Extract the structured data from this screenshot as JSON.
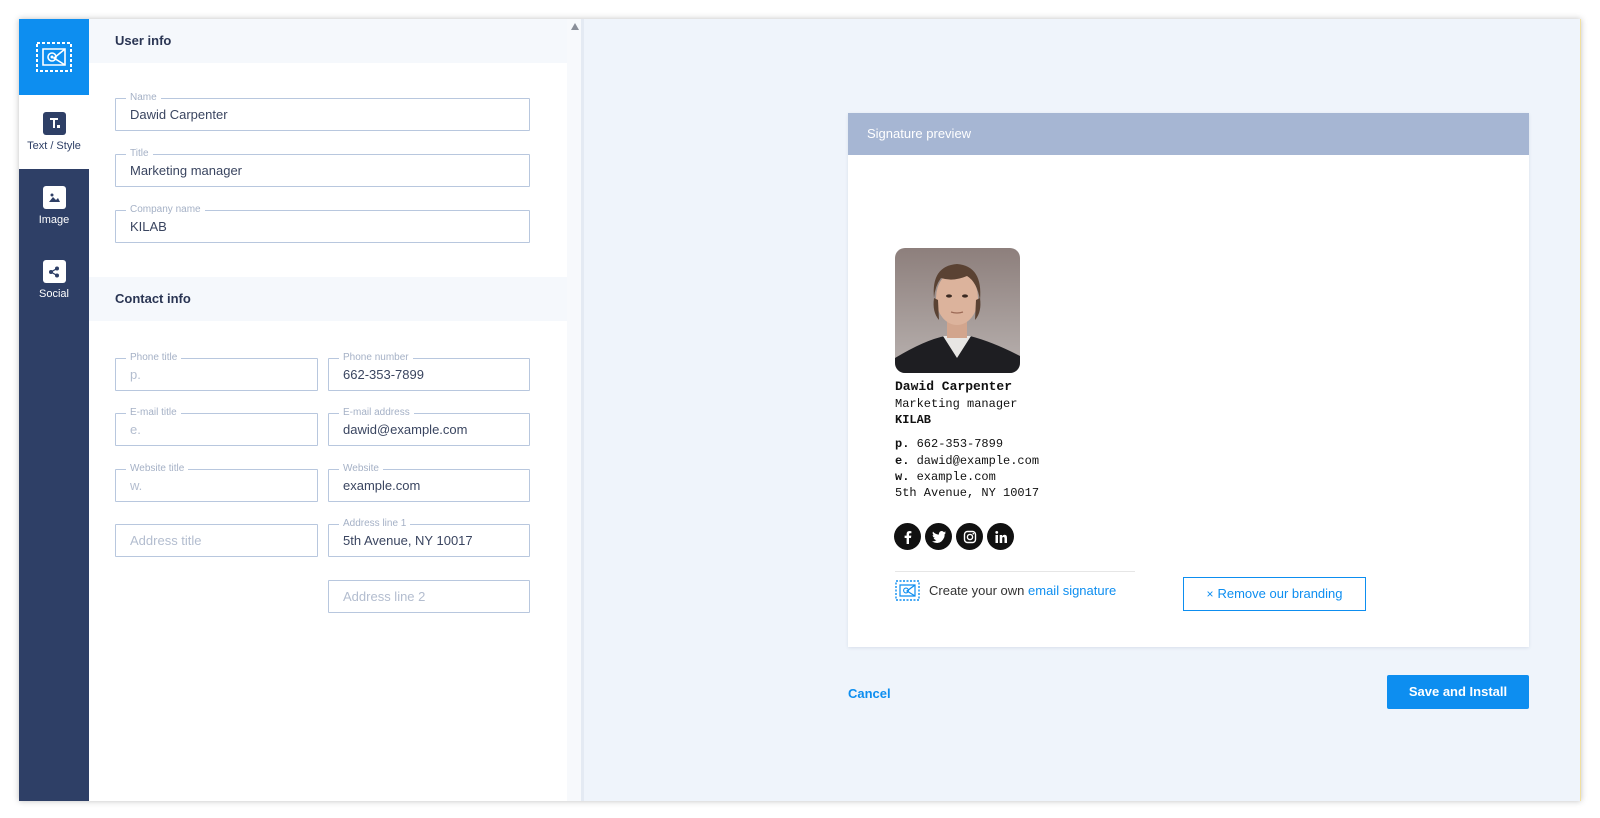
{
  "sidebar": {
    "items": [
      {
        "label": "Text / Style",
        "icon": "text-style-icon"
      },
      {
        "label": "Image",
        "icon": "image-icon"
      },
      {
        "label": "Social",
        "icon": "share-icon"
      }
    ]
  },
  "user_info": {
    "heading": "User info",
    "name": {
      "label": "Name",
      "value": "Dawid Carpenter"
    },
    "title": {
      "label": "Title",
      "value": "Marketing manager"
    },
    "company": {
      "label": "Company name",
      "value": "KILAB"
    }
  },
  "contact_info": {
    "heading": "Contact info",
    "phone_title": {
      "label": "Phone title",
      "placeholder": "p."
    },
    "phone_number": {
      "label": "Phone number",
      "value": "662-353-7899"
    },
    "email_title": {
      "label": "E-mail title",
      "placeholder": "e."
    },
    "email_address": {
      "label": "E-mail address",
      "value": "dawid@example.com"
    },
    "website_title": {
      "label": "Website title",
      "placeholder": "w."
    },
    "website": {
      "label": "Website",
      "value": "example.com"
    },
    "address_title": {
      "placeholder": "Address title"
    },
    "address_line1": {
      "label": "Address line 1",
      "value": "5th Avenue, NY 10017"
    },
    "address_line2": {
      "placeholder": "Address line 2"
    }
  },
  "preview": {
    "header": "Signature preview",
    "name": "Dawid Carpenter",
    "title": "Marketing manager",
    "company": "KILAB",
    "phone_prefix": "p.",
    "phone": "662-353-7899",
    "email_prefix": "e.",
    "email": "dawid@example.com",
    "web_prefix": "w.",
    "website": "example.com",
    "address": "5th Avenue, NY 10017",
    "social_icons": [
      "facebook-icon",
      "twitter-icon",
      "instagram-icon",
      "linkedin-icon"
    ],
    "branding_text": "Create your own",
    "branding_link": "email signature",
    "remove_branding": "Remove our branding"
  },
  "actions": {
    "cancel": "Cancel",
    "save": "Save and Install"
  },
  "colors": {
    "accent": "#0d8ef0",
    "sidebar": "#2e3f66",
    "preview_header": "#a6b6d3"
  }
}
